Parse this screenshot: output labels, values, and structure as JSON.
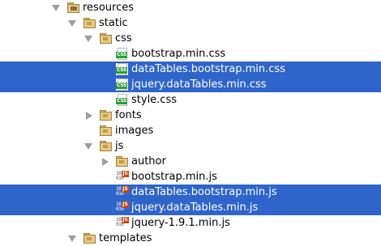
{
  "tree": {
    "items": [
      {
        "label": "resources",
        "depth": 0,
        "kind": "folder-res",
        "arrow": "expanded",
        "selected": false,
        "icon": "resources-folder-icon"
      },
      {
        "label": "static",
        "depth": 1,
        "kind": "folder",
        "arrow": "expanded",
        "selected": false,
        "icon": "folder-icon"
      },
      {
        "label": "css",
        "depth": 2,
        "kind": "folder",
        "arrow": "expanded",
        "selected": false,
        "icon": "folder-icon"
      },
      {
        "label": "bootstrap.min.css",
        "depth": 3,
        "kind": "css",
        "arrow": "none",
        "selected": false,
        "icon": "css-file-icon"
      },
      {
        "label": "dataTables.bootstrap.min.css",
        "depth": 3,
        "kind": "css",
        "arrow": "none",
        "selected": true,
        "icon": "css-file-icon"
      },
      {
        "label": "jquery.dataTables.min.css",
        "depth": 3,
        "kind": "css",
        "arrow": "none",
        "selected": true,
        "icon": "css-file-icon"
      },
      {
        "label": "style.css",
        "depth": 3,
        "kind": "css",
        "arrow": "none",
        "selected": false,
        "icon": "css-file-icon"
      },
      {
        "label": "fonts",
        "depth": 2,
        "kind": "folder",
        "arrow": "collapsed",
        "selected": false,
        "icon": "folder-icon"
      },
      {
        "label": "images",
        "depth": 2,
        "kind": "folder",
        "arrow": "none",
        "selected": false,
        "icon": "folder-icon"
      },
      {
        "label": "js",
        "depth": 2,
        "kind": "folder",
        "arrow": "expanded",
        "selected": false,
        "icon": "folder-icon"
      },
      {
        "label": "author",
        "depth": 3,
        "kind": "folder",
        "arrow": "collapsed",
        "selected": false,
        "icon": "folder-icon"
      },
      {
        "label": "bootstrap.min.js",
        "depth": 3,
        "kind": "js",
        "arrow": "none",
        "selected": false,
        "icon": "js-file-icon"
      },
      {
        "label": "dataTables.bootstrap.min.js",
        "depth": 3,
        "kind": "js",
        "arrow": "none",
        "selected": true,
        "icon": "js-file-icon"
      },
      {
        "label": "jquery.dataTables.min.js",
        "depth": 3,
        "kind": "js",
        "arrow": "none",
        "selected": true,
        "icon": "js-file-icon"
      },
      {
        "label": "jquery-1.9.1.min.js",
        "depth": 3,
        "kind": "js",
        "arrow": "none",
        "selected": false,
        "icon": "js-file-icon"
      },
      {
        "label": "templates",
        "depth": 1,
        "kind": "folder",
        "arrow": "expanded",
        "selected": false,
        "icon": "folder-icon"
      }
    ]
  },
  "icons": {
    "css_badge": "CSS",
    "js_badge": "JS",
    "js_bits": "101\n010"
  },
  "colors": {
    "selection": "#2f65ca",
    "css_badge": "#2f9d3a",
    "js_badge": "#c4460f"
  }
}
